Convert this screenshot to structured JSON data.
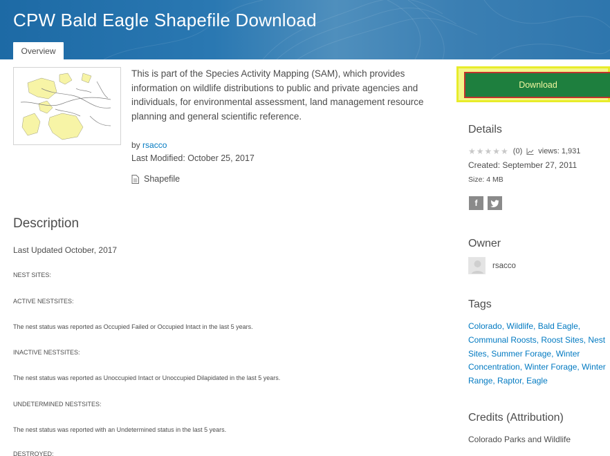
{
  "header": {
    "title": "CPW Bald Eagle Shapefile Download",
    "tabs": [
      {
        "label": "Overview"
      }
    ]
  },
  "summary": {
    "lines": [
      "This is part of the Species Activity Mapping (SAM), which provides",
      "information on wildlife distributions to public and private agencies and",
      "individuals, for environmental assessment, land management resource",
      "planning and general scientific reference."
    ],
    "by_label": "by",
    "owner_link": "rsacco",
    "last_modified": "Last Modified: October 25, 2017",
    "file_type": "Shapefile",
    "file_icon": "document-icon"
  },
  "description": {
    "heading": "Description",
    "lines": [
      "Last Updated October, 2017",
      "NEST SITES:",
      "ACTIVE NESTSITES:",
      "The nest status was reported as Occupied Failed or Occupied Intact in the last 5 years.",
      "INACTIVE NESTSITES:",
      "The nest status was reported as Unoccupied Intact or Unoccupied Dilapidated in the last 5 years.",
      "UNDETERMINED NESTSITES:",
      "The nest status was reported with an Undetermined status in the last 5 years.",
      "DESTROYED:"
    ]
  },
  "sidebar": {
    "download_label": "Download",
    "details_heading": "Details",
    "rating_count": "(0)",
    "views": "views: 1,931",
    "created": "Created: September 27, 2011",
    "size": "Size: 4 MB",
    "share_icons": [
      "facebook-icon",
      "twitter-icon"
    ],
    "owner_heading": "Owner",
    "owner_name": "rsacco",
    "tags_heading": "Tags",
    "tags": [
      "Colorado",
      "Wildlife",
      "Bald Eagle",
      "Communal Roosts",
      "Roost Sites",
      "Nest Sites",
      "Summer Forage",
      "Winter Concentration",
      "Winter Forage",
      "Winter Range",
      "Raptor",
      "Eagle"
    ],
    "credits_heading": "Credits (Attribution)",
    "credits": "Colorado Parks and Wildlife"
  },
  "colors": {
    "banner": "#2a78b2",
    "link": "#0079c1",
    "download_bg": "#1e7f3e",
    "highlight": "#e8ec2a",
    "highlight_border": "#c2322c"
  }
}
